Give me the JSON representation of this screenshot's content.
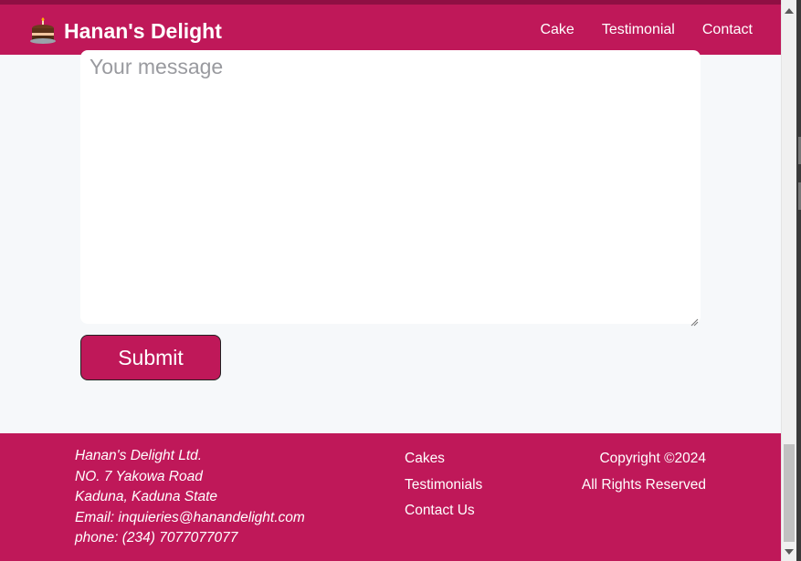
{
  "brand": {
    "name": "Hanan's Delight",
    "icon": "cake-icon"
  },
  "nav": {
    "items": [
      "Cake",
      "Testimonial",
      "Contact"
    ]
  },
  "form": {
    "message_placeholder": "Your message",
    "submit_label": "Submit"
  },
  "footer": {
    "address": {
      "company": "Hanan's Delight Ltd.",
      "street": "NO. 7 Yakowa Road",
      "city": "Kaduna, Kaduna State",
      "email": "Email: inquieries@hanandelight.com",
      "phone": "phone: (234) 7077077077"
    },
    "links": [
      "Cakes",
      "Testimonials",
      "Contact Us"
    ],
    "copyright": "Copyright ©2024",
    "rights": "All Rights Reserved"
  },
  "colors": {
    "brand": "#bf1859",
    "page_bg": "#f6f8fa"
  }
}
